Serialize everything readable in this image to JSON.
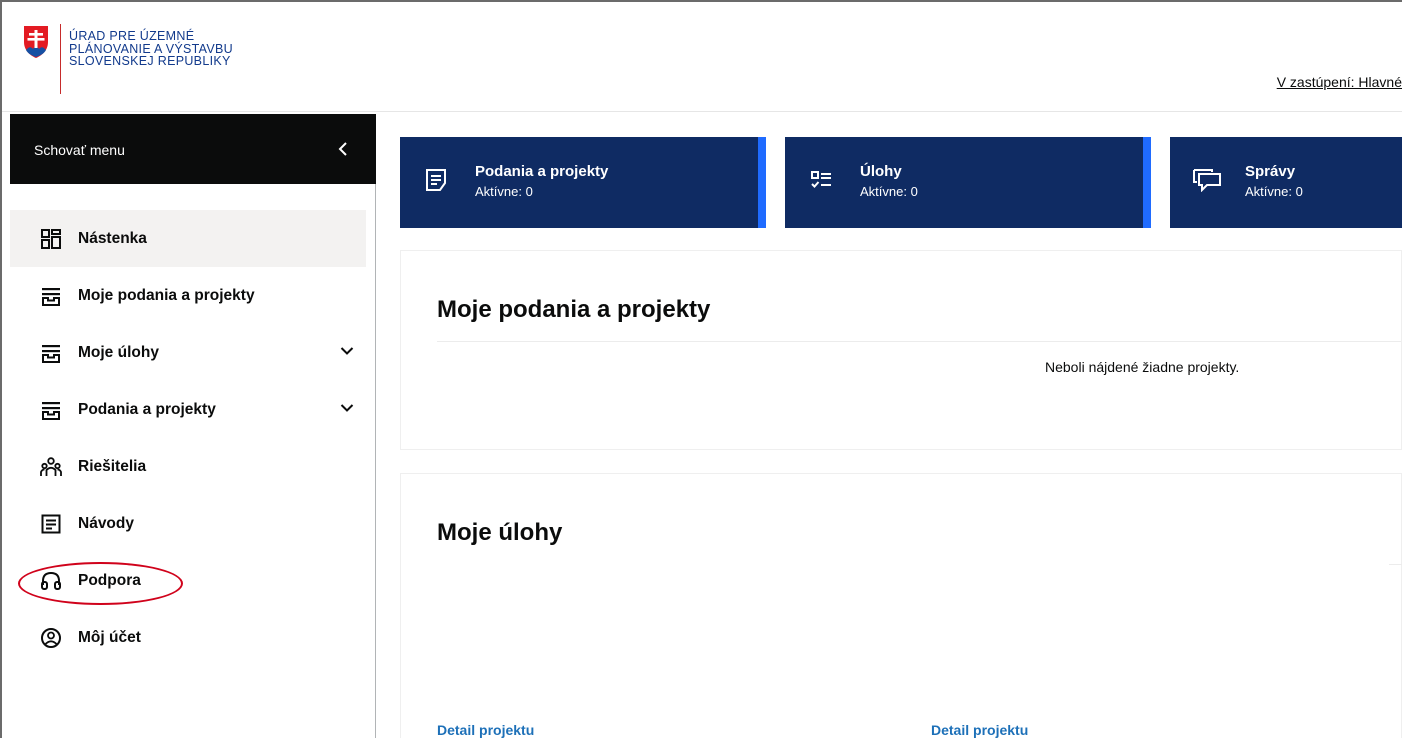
{
  "header": {
    "logo_lines": [
      "ÚRAD PRE ÚZEMNÉ",
      "PLÁNOVANIE A VÝSTAVBU",
      "SLOVENSKEJ REPUBLIKY"
    ],
    "representation": "V zastúpení: Hlavné"
  },
  "sidebar": {
    "hide_menu": "Schovať menu",
    "items": [
      {
        "label": "Nástenka",
        "icon": "dashboard-icon",
        "active": true
      },
      {
        "label": "Moje podania a projekty",
        "icon": "inbox-icon"
      },
      {
        "label": "Moje úlohy",
        "icon": "inbox-icon",
        "expandable": true
      },
      {
        "label": "Podania a projekty",
        "icon": "inbox-icon",
        "expandable": true
      },
      {
        "label": "Riešitelia",
        "icon": "people-icon",
        "highlighted": true
      },
      {
        "label": "Návody",
        "icon": "document-icon"
      },
      {
        "label": "Podpora",
        "icon": "headset-icon"
      },
      {
        "label": "Môj účet",
        "icon": "account-icon"
      }
    ]
  },
  "cards": [
    {
      "title": "Podania a projekty",
      "subtitle": "Aktívne: 0",
      "icon": "document-list-icon"
    },
    {
      "title": "Úlohy",
      "subtitle": "Aktívne: 0",
      "icon": "checklist-icon"
    },
    {
      "title": "Správy",
      "subtitle": "Aktívne: 0",
      "icon": "chat-icon"
    }
  ],
  "main": {
    "projects": {
      "title": "Moje podania a projekty",
      "empty_message": "Neboli nájdené žiadne projekty."
    },
    "tasks": {
      "title": "Moje úlohy",
      "links": [
        "Detail projektu",
        "Detail projektu"
      ]
    }
  },
  "colors": {
    "card_bg": "#0f2b63",
    "card_accent": "#1f6bff",
    "sidebar_top_bg": "#0b0c0c",
    "link": "#1d70b8",
    "highlight": "#d0021b",
    "logo_blue": "#123a8c",
    "logo_red": "#c62b2b"
  }
}
